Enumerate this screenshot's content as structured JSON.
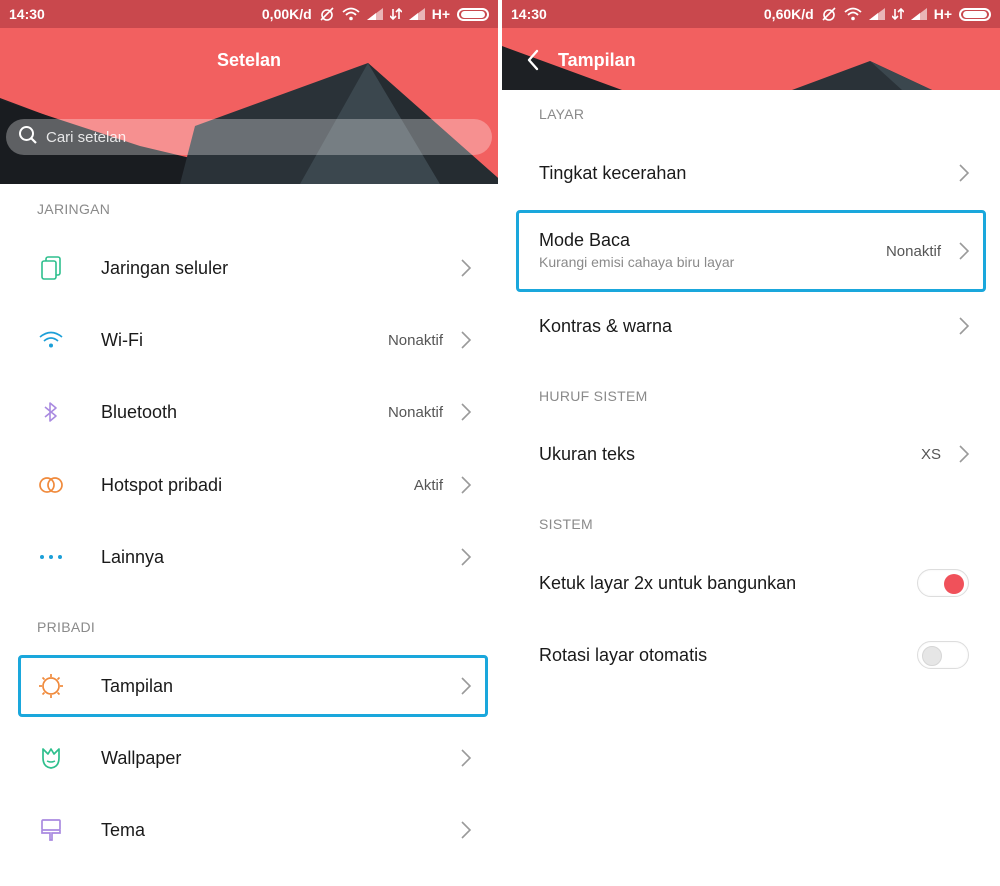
{
  "left": {
    "status": {
      "time": "14:30",
      "speed": "0,00K/d",
      "network": "H+"
    },
    "title": "Setelan",
    "search": {
      "placeholder": "Cari setelan"
    },
    "sections": {
      "jaringan": "JARINGAN",
      "pribadi": "PRIBADI"
    },
    "items": [
      {
        "label": "Jaringan seluler",
        "value": "",
        "icon": "sim-cards-icon"
      },
      {
        "label": "Wi-Fi",
        "value": "Nonaktif",
        "icon": "wifi-icon"
      },
      {
        "label": "Bluetooth",
        "value": "Nonaktif",
        "icon": "bluetooth-icon"
      },
      {
        "label": "Hotspot pribadi",
        "value": "Aktif",
        "icon": "hotspot-icon"
      },
      {
        "label": "Lainnya",
        "value": "",
        "icon": "more-dots-icon"
      },
      {
        "label": "Tampilan",
        "value": "",
        "icon": "display-sun-icon"
      },
      {
        "label": "Wallpaper",
        "value": "",
        "icon": "wallpaper-tulip-icon"
      },
      {
        "label": "Tema",
        "value": "",
        "icon": "theme-brush-icon"
      }
    ]
  },
  "right": {
    "status": {
      "time": "14:30",
      "speed": "0,60K/d",
      "network": "H+"
    },
    "title": "Tampilan",
    "sections": {
      "layar": "LAYAR",
      "huruf": "HURUF SISTEM",
      "sistem": "SISTEM"
    },
    "items": {
      "kecerahan": {
        "label": "Tingkat kecerahan"
      },
      "mode_baca": {
        "label": "Mode Baca",
        "sub": "Kurangi emisi cahaya biru layar",
        "value": "Nonaktif"
      },
      "kontras": {
        "label": "Kontras & warna"
      },
      "ukuran": {
        "label": "Ukuran teks",
        "value": "XS"
      },
      "ketuk": {
        "label": "Ketuk layar 2x untuk bangunkan",
        "toggle": "on"
      },
      "rotasi": {
        "label": "Rotasi layar otomatis",
        "toggle": "off"
      }
    }
  },
  "colors": {
    "header": "#f26060",
    "statusbar": "#c9484d",
    "highlight": "#1aa7dc",
    "toggle_on": "#f0515a"
  }
}
